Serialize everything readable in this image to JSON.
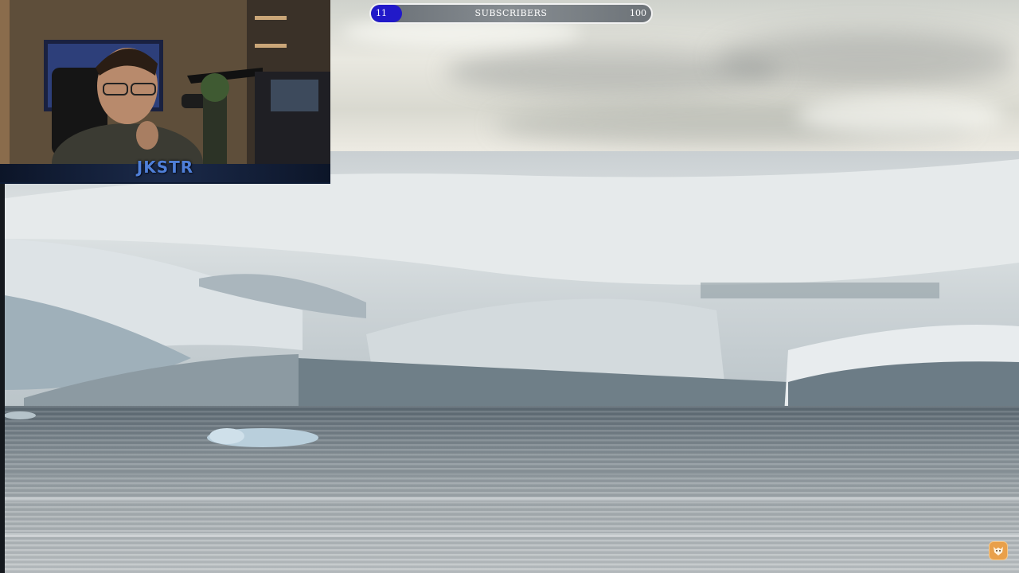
{
  "overlay": {
    "streamer_name": "JKSTR"
  },
  "subscriber_goal": {
    "current": "11",
    "label": "SUBSCRIBERS",
    "target": "100",
    "progress_fraction": 0.11,
    "fill_color": "#2119c9"
  },
  "icons": {
    "corner_badge": "channel-logo-icon"
  }
}
